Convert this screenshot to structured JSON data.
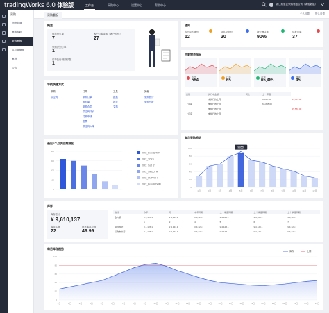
{
  "app": {
    "logo": "tradingWorks 6.0",
    "edition": "体验版"
  },
  "topnav": [
    "工作台",
    "采购中心",
    "设置中心",
    "帮助中心"
  ],
  "header": {
    "company": "浙江商惠云采购有限公司（体验数据）"
  },
  "sidebar": {
    "title": "采购",
    "items": [
      "物资申请",
      "需求发起",
      "采购看板",
      "供应商管理",
      "审批",
      "公告"
    ]
  },
  "tab": {
    "label": "采购看板",
    "actions": [
      "个人设置",
      "默认设置"
    ]
  },
  "summary": {
    "title": "概览",
    "items": [
      {
        "label": "待执行订单",
        "value": "7"
      },
      {
        "label": "客户付款金额（客户总价）",
        "value": "27"
      },
      {
        "label": "采购计划订单",
        "value": "1"
      },
      {
        "label": "订单执行·收货次数",
        "value": "1"
      }
    ]
  },
  "notices": {
    "title": "通知",
    "items": [
      {
        "label": "执行中的询价",
        "value": "12",
        "color": "#f0a020"
      },
      {
        "label": "待答复询价",
        "value": "20",
        "color": "#3a6cf4"
      },
      {
        "label": "报价确认率",
        "value": "90%",
        "color": "#22b573"
      },
      {
        "label": "待批订单",
        "value": "37",
        "color": "#e5484d"
      }
    ]
  },
  "quick": {
    "title": "导航快捷方式",
    "cols": [
      {
        "head": "采购",
        "items": [
          "供应商"
        ]
      },
      {
        "head": "订单",
        "items": [
          "采购订单",
          "询价单",
          "采购合同",
          "供应商评价",
          "付款申请",
          "发票",
          "供应商入库"
        ]
      },
      {
        "head": "工具",
        "items": [
          "数据",
          "报表",
          "文档"
        ]
      },
      {
        "head": "其他",
        "items": [
          "采购统计",
          "采购分析"
        ]
      }
    ]
  },
  "kpi": {
    "title": "主要物资指标",
    "cards": [
      {
        "label": "合同",
        "value": "564",
        "color": "#e5484d"
      },
      {
        "label": "订单",
        "value": "65",
        "color": "#f0a020"
      },
      {
        "label": "收货",
        "value": "65,485",
        "color": "#22b573"
      },
      {
        "label": "退货",
        "value": "45",
        "color": "#3a6cf4"
      }
    ],
    "table": {
      "headers": [
        "类别",
        "执行中金额",
        "同比",
        "上一年度"
      ],
      "rows": [
        [
          "",
          "未执行的上月",
          "",
          "9,850.90",
          "15,355.90"
        ],
        [
          "上周期",
          "未执行的上月",
          "",
          "65,845.00",
          ""
        ],
        [
          "",
          "未执行的上月",
          "",
          "",
          "25,580.00"
        ],
        [
          "上年度",
          "未执行的上月",
          "",
          "",
          ""
        ]
      ]
    }
  },
  "bars": {
    "title": "最后6个月供应商排名",
    "chart_data": {
      "type": "bar",
      "categories": [
        "B1",
        "B2",
        "B3",
        "B4",
        "B5",
        "B6"
      ],
      "series": [
        {
          "name": "Vol",
          "values": [
            320,
            300,
            250,
            160,
            85,
            45
          ]
        }
      ],
      "ylim": [
        0,
        400
      ],
      "yticks": [
        "400",
        "300",
        "200",
        "100",
        "0"
      ]
    },
    "legend": [
      "XXX_Brands TOK",
      "XXX_TOKS",
      "XXX_Sort UT",
      "XXX_SMOOTH",
      "XXX_SMPTCH",
      "XXX_Brands DOM"
    ],
    "colors": [
      "#2f57d9",
      "#4a6fe0",
      "#6b88e8",
      "#8fa5ee",
      "#b3c2f4",
      "#d3dcf8"
    ]
  },
  "monthly": {
    "title": "每月采购趋势",
    "tooltip": "9,8555",
    "chart_data": {
      "type": "bar",
      "categories": [
        "1月",
        "2月",
        "3月",
        "4月",
        "5月",
        "6月",
        "7月",
        "8月",
        "9月",
        "10月",
        "11月",
        "12月"
      ],
      "values": [
        30,
        55,
        60,
        80,
        90,
        70,
        65,
        55,
        48,
        42,
        30,
        25
      ],
      "ylim": [
        0,
        100
      ],
      "yticks": [
        "100",
        "80",
        "60",
        "40",
        "20",
        "0"
      ]
    }
  },
  "stats": {
    "title": "库存",
    "big_label": "库存总计",
    "big_value": "¥ 9,610,137",
    "sub": [
      {
        "label": "库存件数",
        "value": "22"
      },
      {
        "label": "现有库存总数",
        "value": "49.99"
      }
    ],
    "table": {
      "headers": [
        "指标",
        "今年",
        "月",
        "本年同期",
        "上个季度同期",
        "上个季度同期",
        "上个季度同期"
      ],
      "rows": [
        [
          "收入额",
          "¥ 4,123.1",
          "¥ 4,123.1",
          "¥ 4,123.1",
          "¥ 4,123.1",
          "¥ 4,123.1",
          "¥ 4,123.1"
        ],
        [
          "",
          "1",
          "2",
          "4",
          "5",
          "6",
          "7"
        ],
        [
          "额外成交",
          "¥ 4,123.1",
          "¥ 4,123.1",
          "¥ 4,123.1",
          "¥ 4,123.1",
          "¥ 4,123.1",
          "¥ 4,123.1"
        ],
        [
          "采购未执行",
          "¥ 4,123.1",
          "¥ 4,123.1",
          "¥ 4,123.1",
          "¥ 4,123.1",
          "¥ 4,123.1",
          "¥ 4,123.1"
        ]
      ]
    }
  },
  "trend": {
    "title": "每日库存趋势",
    "legend": [
      "库存",
      "上期"
    ],
    "chart_data": {
      "type": "area",
      "x": [
        "1日",
        "2日",
        "3日",
        "4日",
        "5日",
        "6日",
        "7日",
        "8日",
        "9日",
        "10日",
        "11日",
        "12日",
        "13日",
        "14日",
        "15日",
        "16日",
        "17日",
        "18日",
        "19日",
        "20日",
        "21日",
        "22日",
        "23日",
        "24日",
        "25日"
      ],
      "series": [
        {
          "name": "库存",
          "values": [
            25,
            30,
            35,
            40,
            45,
            55,
            65,
            75,
            82,
            85,
            78,
            68,
            60,
            52,
            45,
            40,
            38,
            36,
            34,
            33,
            35,
            37,
            40,
            43,
            45
          ]
        },
        {
          "name": "上期",
          "values": [
            80,
            80,
            80,
            80,
            80,
            80,
            80,
            80,
            80,
            80,
            80,
            80,
            80,
            80,
            80,
            80,
            80,
            80,
            80,
            80,
            80,
            80,
            80,
            80,
            80
          ]
        }
      ],
      "ylim": [
        0,
        100
      ],
      "yticks": [
        "100",
        "80",
        "60",
        "40",
        "20",
        "0"
      ]
    }
  }
}
